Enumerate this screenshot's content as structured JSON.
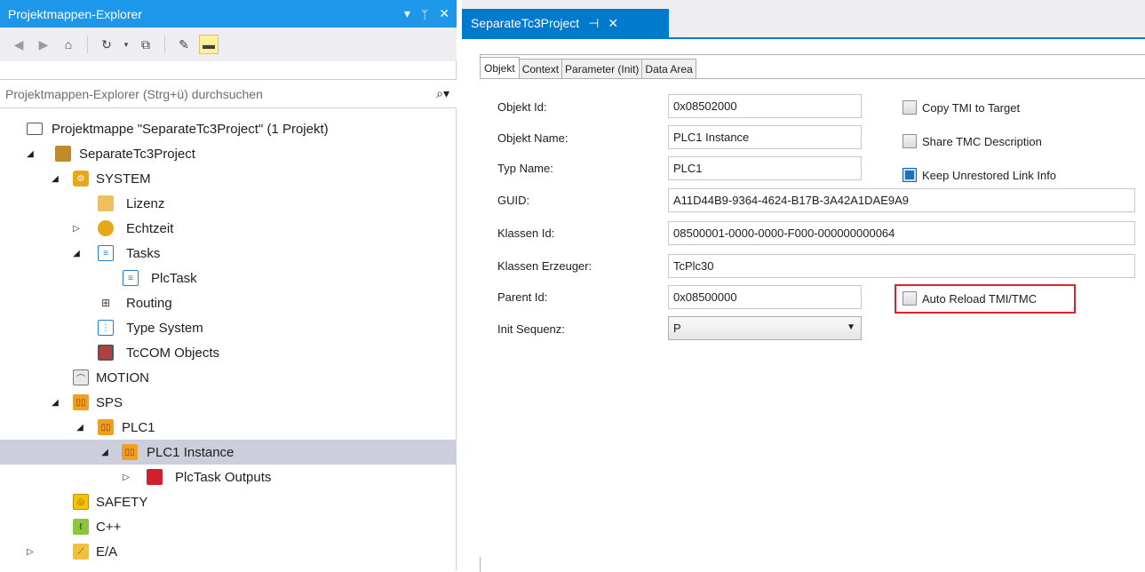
{
  "solution_explorer": {
    "title": "Projektmappen-Explorer",
    "title_controls": [
      "▾",
      "ᛘ",
      "✕"
    ],
    "search_placeholder": "Projektmappen-Explorer (Strg+ü) durchsuchen",
    "search_icon": "⌕▾",
    "tree": [
      {
        "label": "Projektmappe \"SeparateTc3Project\" (1 Projekt)",
        "icon": "solution-icon",
        "expander": ""
      },
      {
        "label": "SeparateTc3Project",
        "icon": "project-icon",
        "expander": "◢"
      },
      {
        "label": "SYSTEM",
        "icon": "system-icon",
        "expander": "◢"
      },
      {
        "label": "Lizenz",
        "icon": "license-icon",
        "expander": ""
      },
      {
        "label": "Echtzeit",
        "icon": "realtime-icon",
        "expander": "▷"
      },
      {
        "label": "Tasks",
        "icon": "tasks-icon",
        "expander": "◢"
      },
      {
        "label": "PlcTask",
        "icon": "task-icon",
        "expander": ""
      },
      {
        "label": "Routing",
        "icon": "routing-icon",
        "expander": ""
      },
      {
        "label": "Type System",
        "icon": "type-system-icon",
        "expander": ""
      },
      {
        "label": "TcCOM Objects",
        "icon": "tccom-icon",
        "expander": ""
      },
      {
        "label": "MOTION",
        "icon": "motion-icon",
        "expander": ""
      },
      {
        "label": "SPS",
        "icon": "sps-icon",
        "expander": "◢"
      },
      {
        "label": "PLC1",
        "icon": "plc-icon",
        "expander": "◢"
      },
      {
        "label": "PLC1 Instance",
        "icon": "plc-instance-icon",
        "expander": "◢"
      },
      {
        "label": "PlcTask Outputs",
        "icon": "outputs-icon",
        "expander": "▷"
      },
      {
        "label": "SAFETY",
        "icon": "safety-icon",
        "expander": ""
      },
      {
        "label": "C++",
        "icon": "cpp-icon",
        "expander": ""
      },
      {
        "label": "E/A",
        "icon": "io-icon",
        "expander": "▷"
      }
    ]
  },
  "document": {
    "tab_title": "SeparateTc3Project",
    "tab_controls": [
      "⊣",
      "✕"
    ],
    "property_tabs": [
      "Objekt",
      "Context",
      "Parameter (Init)",
      "Data Area"
    ],
    "fields": {
      "objekt_id": {
        "label": "Objekt Id:",
        "value": "0x08502000"
      },
      "objekt_name": {
        "label": "Objekt Name:",
        "value": "PLC1 Instance"
      },
      "typ_name": {
        "label": "Typ Name:",
        "value": "PLC1"
      },
      "guid": {
        "label": "GUID:",
        "value": "A11D44B9-9364-4624-B17B-3A42A1DAE9A9"
      },
      "klassen_id": {
        "label": "Klassen Id:",
        "value": "08500001-0000-0000-F000-000000000064"
      },
      "klassen_erzeuger": {
        "label": "Klassen Erzeuger:",
        "value": "TcPlc30"
      },
      "parent_id": {
        "label": "Parent Id:",
        "value": "0x08500000"
      },
      "init_sequenz": {
        "label": "Init Sequenz:",
        "value": "P"
      }
    },
    "checkboxes": {
      "copy_tmi": {
        "label": "Copy TMI to Target",
        "checked": false
      },
      "share_tmc": {
        "label": "Share TMC Description",
        "checked": false
      },
      "keep_unrestored": {
        "label": "Keep Unrestored Link Info",
        "checked": true
      },
      "auto_reload": {
        "label": "Auto Reload TMI/TMC",
        "checked": false
      }
    }
  },
  "colors": {
    "accent": "#007acc",
    "title_active": "#1c97ea",
    "highlight": "#e0202a",
    "selection": "#cccedb"
  }
}
